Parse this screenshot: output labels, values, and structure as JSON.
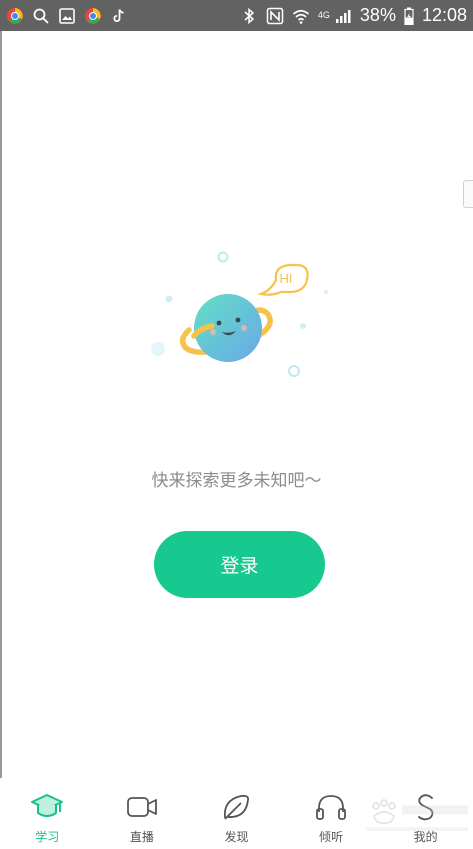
{
  "status_bar": {
    "network_type": "4G",
    "battery_percent": "38%",
    "time": "12:08",
    "icons": [
      "browser-icon",
      "search-icon",
      "gallery-icon",
      "browser-icon",
      "tiktok-icon",
      "bluetooth-icon",
      "nfc-icon",
      "wifi-icon",
      "signal-icon",
      "battery-icon"
    ]
  },
  "illustration": {
    "bubble_text": "HI",
    "colors": {
      "planet": "#5fd7c5",
      "ring": "#f5c34a",
      "bubble": "#f5c34a",
      "dots": "#bfe9f3"
    }
  },
  "main": {
    "empty_message": "快来探索更多未知吧～",
    "login_label": "登录"
  },
  "bottom_nav": {
    "items": [
      {
        "label": "学习",
        "icon": "graduation-cap-icon",
        "active": true
      },
      {
        "label": "直播",
        "icon": "video-camera-icon",
        "active": false
      },
      {
        "label": "发现",
        "icon": "leaf-icon",
        "active": false
      },
      {
        "label": "倾听",
        "icon": "headphones-icon",
        "active": false
      },
      {
        "label": "我的",
        "icon": "profile-icon",
        "active": false
      }
    ]
  },
  "colors": {
    "accent": "#17c88f",
    "status_bar": "#626262"
  }
}
